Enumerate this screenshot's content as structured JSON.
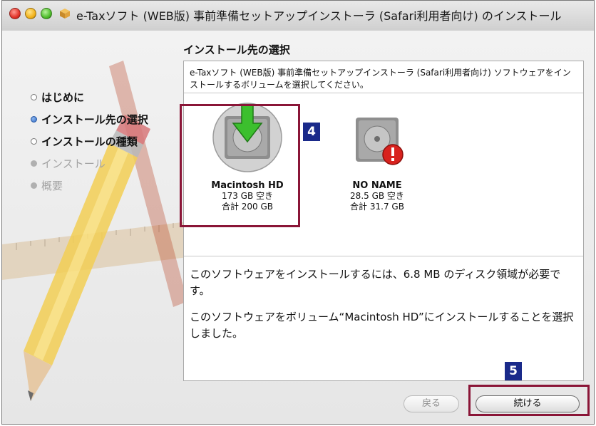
{
  "window": {
    "title": "e-Taxソフト (WEB版) 事前準備セットアップインストーラ (Safari利用者向け) のインストール"
  },
  "page": {
    "heading": "インストール先の選択"
  },
  "steps": [
    {
      "label": "はじめに",
      "state": "done"
    },
    {
      "label": "インストール先の選択",
      "state": "current"
    },
    {
      "label": "インストールの種類",
      "state": "done"
    },
    {
      "label": "インストール",
      "state": "pending"
    },
    {
      "label": "概要",
      "state": "pending"
    }
  ],
  "panel": {
    "description": "e-Taxソフト (WEB版) 事前準備セットアップインストーラ (Safari利用者向け) ソフトウェアをインストールするボリュームを選択してください。",
    "volumes": [
      {
        "name": "Macintosh HD",
        "free": "173 GB 空き",
        "total": "合計 200 GB",
        "icon": "hard-disk-install-arrow-icon"
      },
      {
        "name": "NO NAME",
        "free": "28.5 GB 空き",
        "total": "合計 31.7 GB",
        "icon": "hard-disk-warning-icon"
      }
    ],
    "info1": "このソフトウェアをインストールするには、6.8 MB のディスク領域が必要です。",
    "info2": "このソフトウェアをボリューム“Macintosh HD”にインストールすることを選択しました。"
  },
  "buttons": {
    "back": "戻る",
    "continue": "続ける"
  },
  "annotations": {
    "badge_volume": "4",
    "badge_continue": "5",
    "callout_color": "#8a1537",
    "badge_color": "#1a2a8a"
  }
}
